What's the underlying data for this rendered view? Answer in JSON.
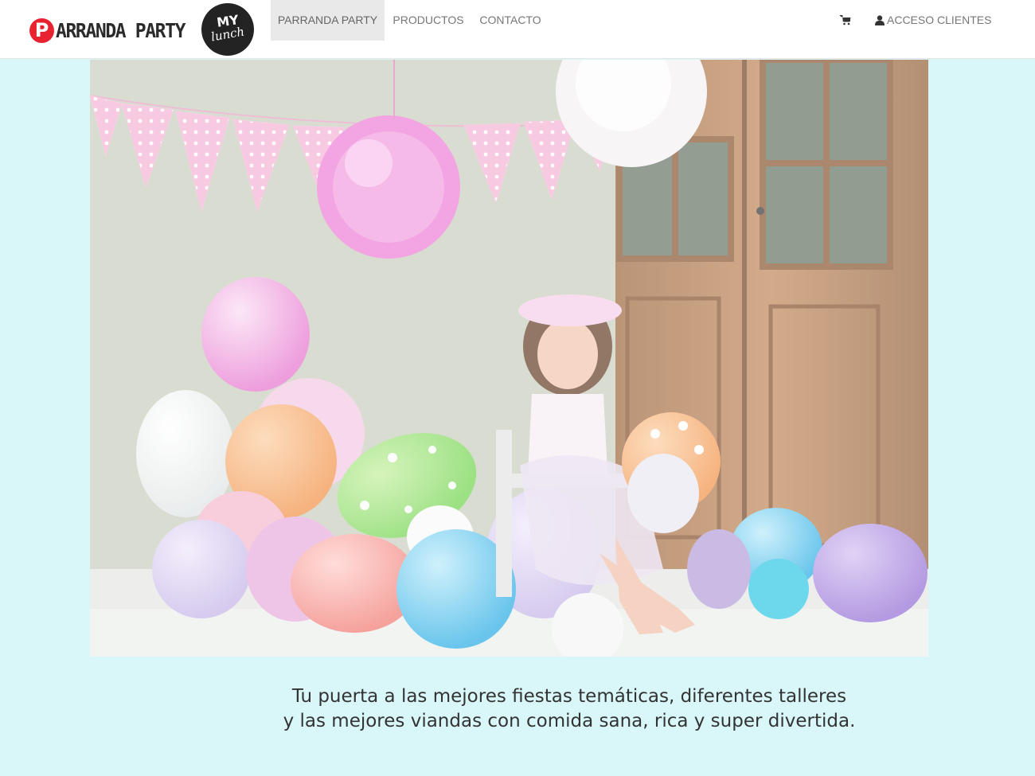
{
  "brand": {
    "initial": "P",
    "name": "ARRANDA PARTY",
    "partner_logo_top": "MY",
    "partner_logo_bottom": "lunch"
  },
  "nav": {
    "items": [
      {
        "label": "PARRANDA PARTY",
        "active": true
      },
      {
        "label": "PRODUCTOS",
        "active": false
      },
      {
        "label": "CONTACTO",
        "active": false
      }
    ],
    "cart_icon": "shopping-cart-icon",
    "user_icon": "user-icon",
    "account_label": "ACCESO CLIENTES"
  },
  "hero": {
    "image": "party-photo"
  },
  "tagline": {
    "line1": "Tu puerta a las mejores fiestas temáticas, diferentes talleres",
    "line2": "y las mejores viandas con comida sana, rica y super divertida."
  },
  "colors": {
    "page_bg": "#d9f7f9",
    "brand_red": "#e8222e",
    "nav_text": "#777777",
    "nav_active_bg": "#e9e9e9"
  }
}
